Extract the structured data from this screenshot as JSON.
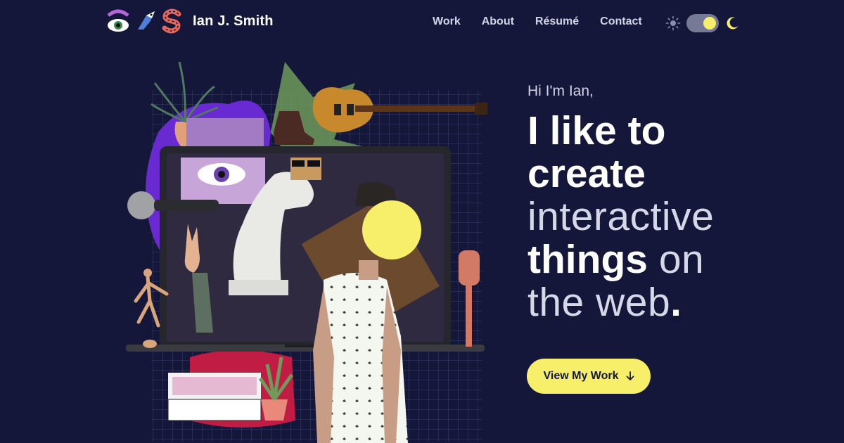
{
  "header": {
    "logo_name": "Ian J. Smith",
    "logo_icons": [
      "eye-icon",
      "bird-icon",
      "letter-s-icon"
    ],
    "nav": [
      {
        "label": "Work"
      },
      {
        "label": "About"
      },
      {
        "label": "Résumé"
      },
      {
        "label": "Contact"
      }
    ],
    "theme": {
      "light_icon": "sun-icon",
      "dark_icon": "moon-icon",
      "mode": "dark"
    }
  },
  "hero": {
    "greeting": "Hi I'm Ian,",
    "line1": "I like to",
    "line2": "create",
    "line3": "interactive",
    "line4_bold": "things",
    "line4_light": "on",
    "line5_light": "the web",
    "line5_dot": ".",
    "cta_label": "View My Work",
    "cta_icon": "arrow-down-icon"
  },
  "colors": {
    "background": "#14163a",
    "accent": "#f7ee6a",
    "purple": "#6a2ad1",
    "green": "#6f9a5c"
  }
}
